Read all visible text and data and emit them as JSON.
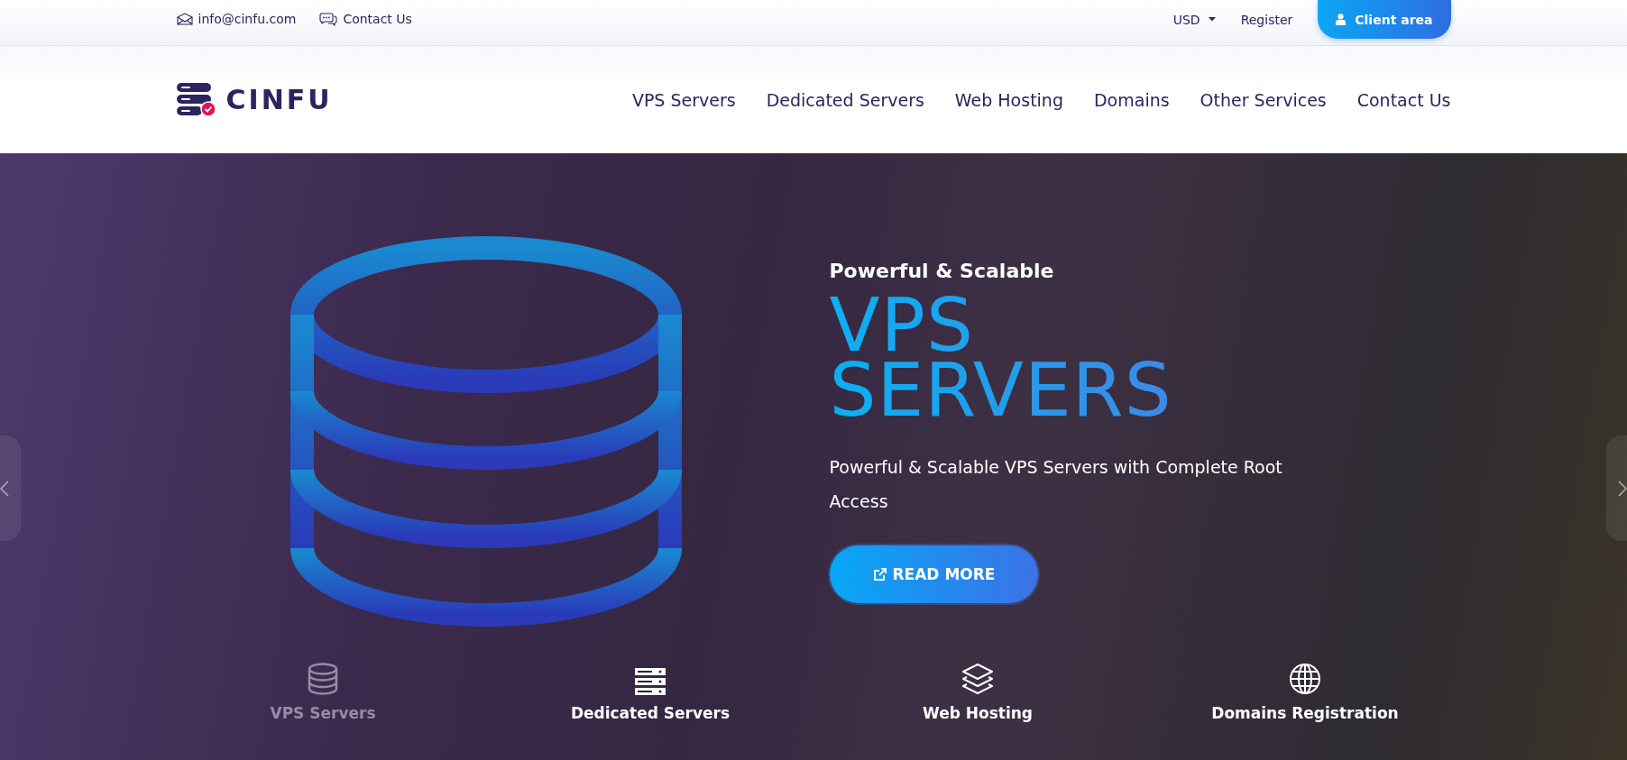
{
  "topbar": {
    "email": "info@cinfu.com",
    "contact": "Contact Us",
    "currency": "USD",
    "register": "Register",
    "client_area": "Client area"
  },
  "logo": {
    "text": "CINFU"
  },
  "nav": [
    {
      "label": "VPS Servers"
    },
    {
      "label": "Dedicated Servers"
    },
    {
      "label": "Web Hosting"
    },
    {
      "label": "Domains"
    },
    {
      "label": "Other Services"
    },
    {
      "label": "Contact Us"
    }
  ],
  "hero": {
    "kicker": "Powerful & Scalable",
    "title_lines": [
      "VPS",
      "SERVERS"
    ],
    "description": "Powerful & Scalable VPS Servers with Complete Root Access",
    "button": "READ MORE"
  },
  "slide_tabs": [
    {
      "label": "VPS Servers",
      "kind": "database",
      "selected": true
    },
    {
      "label": "Dedicated Servers",
      "kind": "server",
      "selected": false
    },
    {
      "label": "Web Hosting",
      "kind": "layers",
      "selected": false
    },
    {
      "label": "Domains Registration",
      "kind": "globe",
      "selected": false
    }
  ]
}
